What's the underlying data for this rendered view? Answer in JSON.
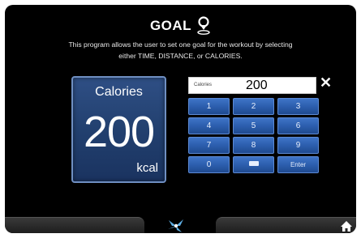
{
  "header": {
    "title": "GOAL",
    "description_line1": "This program allows the user to set one goal for the workout by selecting",
    "description_line2": "either TIME, DISTANCE, or CALORIES."
  },
  "goal_card": {
    "label": "Calories",
    "value": "200",
    "unit": "kcal"
  },
  "entry": {
    "label": "Calories",
    "value": "200",
    "clear_label": "✕"
  },
  "keypad": {
    "k1": "1",
    "k2": "2",
    "k3": "3",
    "k4": "4",
    "k5": "5",
    "k6": "6",
    "k7": "7",
    "k8": "8",
    "k9": "9",
    "k0": "0",
    "enter": "Enter"
  },
  "icons": {
    "title_icon": "location-pin-icon",
    "backspace_icon": "backspace-icon",
    "center_icon": "fan-icon",
    "home_icon": "home-icon"
  },
  "colors": {
    "background": "#000000",
    "key_blue": "#2b5cab",
    "card_blue": "#22406f",
    "text": "#ffffff"
  }
}
